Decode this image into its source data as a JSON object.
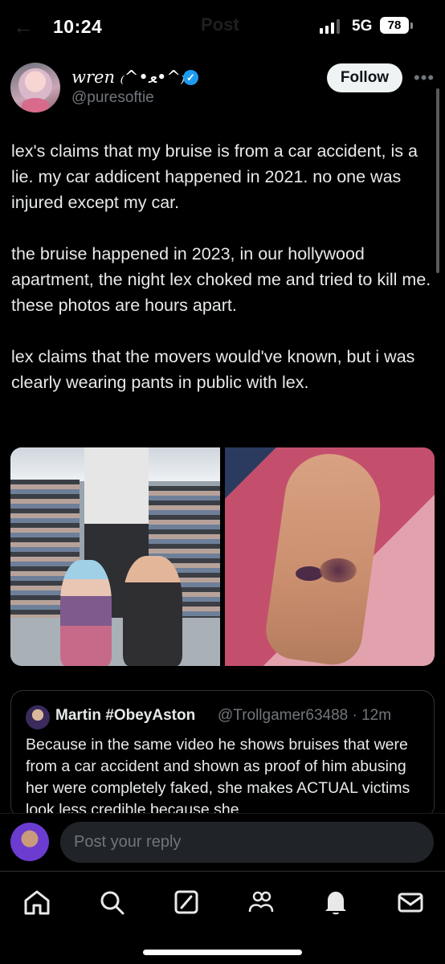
{
  "status_bar": {
    "time": "10:24",
    "network": "5G",
    "battery": "78"
  },
  "ghost_header": {
    "back_icon": "back-arrow-icon",
    "title": "Post"
  },
  "author": {
    "display_name": "wren ₍^•ﻌ•^₎",
    "handle": "@puresoftie",
    "verified": true,
    "follow_label": "Follow"
  },
  "tweet": {
    "paragraphs": [
      "lex's claims that my bruise is from a car accident, is a lie. my car addicent happened in 2021. no one was injured except my car.",
      "the bruise happened in 2023, in our hollywood apartment, the night lex choked me and tried to kill me. these photos are hours apart.",
      "lex claims that the movers would've known, but i was clearly wearing pants in public with lex."
    ]
  },
  "media": [
    {
      "name": "store-photo"
    },
    {
      "name": "bruise-photo"
    }
  ],
  "quote": {
    "name": "Martin #ObeyAston",
    "meta": "@Trollgamer63488 · 12m",
    "text": "Because in the same video he shows bruises that were from a car accident and shown as proof of him abusing her were completely faked, she makes ACTUAL victims look less credible because she"
  },
  "reply": {
    "placeholder": "Post your reply"
  },
  "nav": [
    {
      "name": "home-icon"
    },
    {
      "name": "search-icon"
    },
    {
      "name": "grok-icon"
    },
    {
      "name": "communities-icon"
    },
    {
      "name": "notifications-icon"
    },
    {
      "name": "messages-icon"
    }
  ],
  "colors": {
    "background": "#000000",
    "text": "#e7e9ea",
    "muted": "#71767b",
    "verified": "#1d9bf0",
    "follow_bg": "#eff3f4"
  }
}
